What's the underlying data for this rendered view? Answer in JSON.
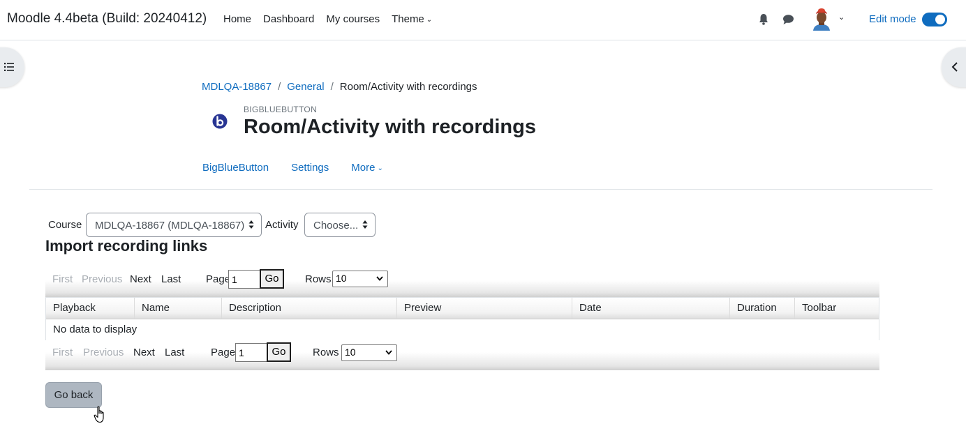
{
  "navbar": {
    "site_name": "Moodle 4.4beta (Build: 20240412)",
    "primary_links": [
      "Home",
      "Dashboard",
      "My courses"
    ],
    "theme_label": "Theme",
    "edit_mode_label": "Edit mode",
    "edit_mode_on": true
  },
  "breadcrumb": {
    "items": [
      "MDLQA-18867",
      "General"
    ],
    "current": "Room/Activity with recordings"
  },
  "activity": {
    "module_type": "BIGBLUEBUTTON",
    "title": "Room/Activity with recordings"
  },
  "secondary_nav": {
    "tabs": [
      "BigBlueButton",
      "Settings"
    ],
    "more_label": "More"
  },
  "selectors": {
    "course_label": "Course",
    "course_value": "MDLQA-18867 (MDLQA-18867)",
    "activity_label": "Activity",
    "activity_value": "Choose..."
  },
  "section": {
    "heading": "Import recording links"
  },
  "paging": {
    "first": "First",
    "previous": "Previous",
    "next": "Next",
    "last": "Last",
    "page_label": "Page",
    "page_value": "1",
    "go_label": "Go",
    "rows_label": "Rows",
    "rows_value": "10"
  },
  "table": {
    "columns": [
      "Playback",
      "Name",
      "Description",
      "Preview",
      "Date",
      "Duration",
      "Toolbar"
    ],
    "empty_message": "No data to display"
  },
  "actions": {
    "go_back": "Go back"
  },
  "colors": {
    "link": "#0f6cbf",
    "text": "#1d2125",
    "muted": "#6a737b",
    "toggle_on": "#0f6cbf",
    "button_secondary": "#aeb7c1"
  },
  "icons": {
    "notifications": "bell-icon",
    "messages": "chat-icon",
    "course_index": "list-icon",
    "block_drawer": "chevron-left-icon",
    "module": "bigbluebutton-icon"
  }
}
